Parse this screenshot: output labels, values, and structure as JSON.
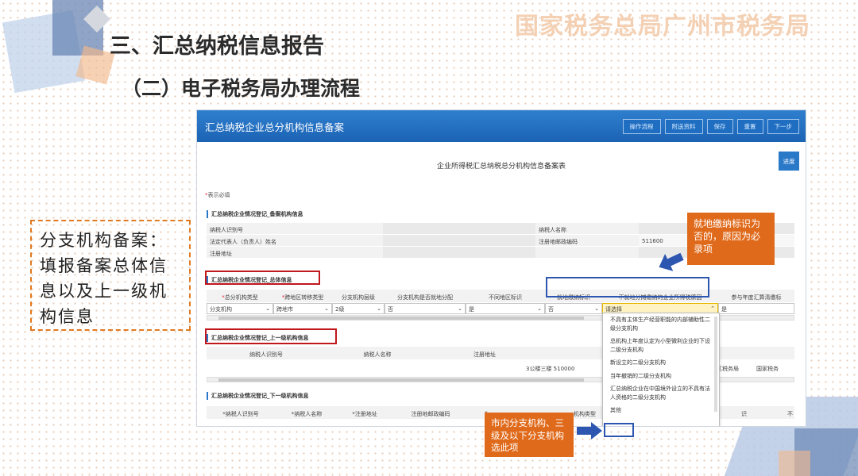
{
  "slide": {
    "heading": "三、汇总纳税信息报告",
    "subheading": "（二）电子税务局办理流程",
    "watermark": "国家税务总局广州市税务局"
  },
  "app": {
    "title": "汇总纳税企业总分机构信息备案",
    "buttons": [
      "操作流程",
      "附送资料",
      "保存",
      "重置",
      "下一步"
    ],
    "form_title": "企业所得税汇总纳税总分机构信息备案表",
    "progress_button": "进度",
    "required_note": "表示必填",
    "section1": {
      "title": "汇总纳税企业情况登记_备案机构信息",
      "rows": [
        {
          "left_label": "纳税人识别号",
          "right_label": "纳税人名称",
          "right_value": ""
        },
        {
          "left_label": "法定代表人（负责人）姓名",
          "right_label": "注册地邮政编码",
          "right_value": "511600"
        },
        {
          "left_label": "注册地址",
          "right_label": "",
          "right_value": ""
        }
      ]
    },
    "section2": {
      "title": "汇总纳税企业情况登记_总体信息",
      "headers": [
        "总分机构类型",
        "跨地区转移类型",
        "分支机构层级",
        "分支机构是否就地分配",
        "不同地区标识",
        "就地缴纳标识",
        "不就地分摊缴纳的企业所得税原因",
        "参与年度汇算清缴标"
      ],
      "required_headers": [
        true,
        true,
        false,
        false,
        false,
        false,
        false,
        false
      ],
      "values": [
        "分支机构",
        "跨地市",
        "2级",
        "否",
        "是",
        "否",
        "请选择",
        "是"
      ]
    },
    "dropdown": {
      "options": [
        "不具有主体生产经营职能的内部辅助性二级分支机构",
        "总机构上年度认定为小型微利企业的下设二级分支机构",
        "新设立的二级分支机构",
        "当年撤销的二级分支机构",
        "汇总纳税企业在中国境外设立的不具有法人资格的二级分支机构",
        "其他"
      ]
    },
    "section3": {
      "title": "汇总纳税企业情况登记_上一级机构信息",
      "headers": [
        "纳税人识别号",
        "纳税人名称",
        "注册地址",
        "注册地邮"
      ],
      "row_address": "3公楼三楼 510000",
      "right_header": "关",
      "right_values": [
        "区税务局",
        "国家税务"
      ]
    },
    "section4": {
      "title": "汇总纳税企业情况登记_下一级机构信息",
      "headers": [
        "*纳税人识别号",
        "*纳税人名称",
        "*注册地址",
        "注册地邮政编码",
        "*",
        "机构类型",
        "识",
        "不"
      ]
    }
  },
  "callouts": {
    "top": "就地缴纳标识为否的，原因为必录项",
    "bottom": "市内分支机构、三级及以下分支机构选此项"
  },
  "side_note": "分支机构备案：填报备案总体信息以及上一级机构信息",
  "colors": {
    "header_blue": "#1c63b4",
    "callout_orange": "#e06a1b",
    "red_box": "#c0171c",
    "blue_box": "#2d56b0"
  }
}
